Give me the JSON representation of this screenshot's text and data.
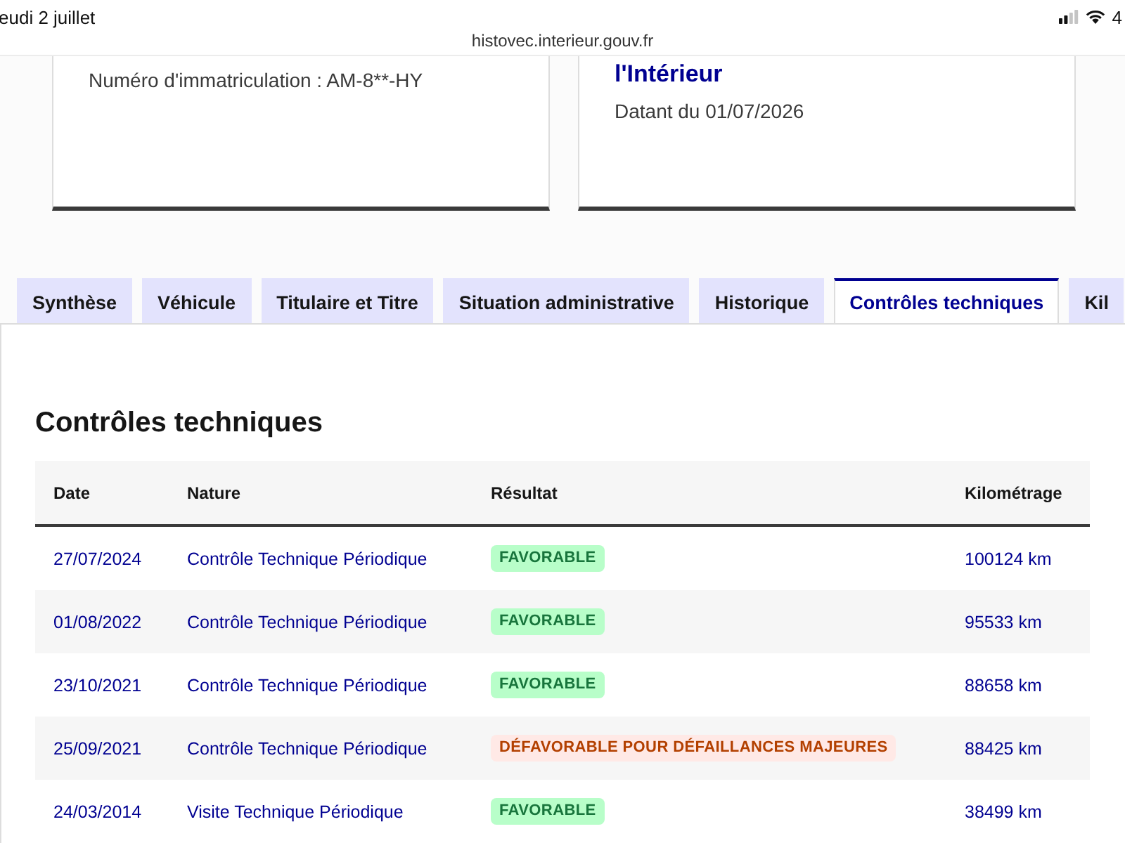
{
  "status_bar": {
    "date": "eudi 2 juillet",
    "battery": "4"
  },
  "browser": {
    "url": "histovec.interieur.gouv.fr"
  },
  "cards": [
    {
      "text": "Numéro d'immatriculation : AM-8**-HY"
    },
    {
      "title": "l'Intérieur",
      "text": "Datant du 01/07/2026"
    }
  ],
  "tabs": [
    {
      "label": "Synthèse",
      "selected": false
    },
    {
      "label": "Véhicule",
      "selected": false
    },
    {
      "label": "Titulaire et Titre",
      "selected": false
    },
    {
      "label": "Situation administrative",
      "selected": false
    },
    {
      "label": "Historique",
      "selected": false
    },
    {
      "label": "Contrôles techniques",
      "selected": true
    },
    {
      "label": "Kil",
      "selected": false
    }
  ],
  "section": {
    "title": "Contrôles techniques"
  },
  "table": {
    "columns": [
      "Date",
      "Nature",
      "Résultat",
      "Kilométrage"
    ],
    "rows": [
      {
        "date": "27/07/2024",
        "nature": "Contrôle Technique Périodique",
        "result": {
          "label": "FAVORABLE",
          "kind": "success"
        },
        "mileage": "100124 km"
      },
      {
        "date": "01/08/2022",
        "nature": "Contrôle Technique Périodique",
        "result": {
          "label": "FAVORABLE",
          "kind": "success"
        },
        "mileage": "95533 km"
      },
      {
        "date": "23/10/2021",
        "nature": "Contrôle Technique Périodique",
        "result": {
          "label": "FAVORABLE",
          "kind": "success"
        },
        "mileage": "88658 km"
      },
      {
        "date": "25/09/2021",
        "nature": "Contrôle Technique Périodique",
        "result": {
          "label": "DÉFAVORABLE POUR DÉFAILLANCES MAJEURES",
          "kind": "error"
        },
        "mileage": "88425 km"
      },
      {
        "date": "24/03/2014",
        "nature": "Visite Technique Périodique",
        "result": {
          "label": "FAVORABLE",
          "kind": "success"
        },
        "mileage": "38499 km"
      }
    ]
  }
}
